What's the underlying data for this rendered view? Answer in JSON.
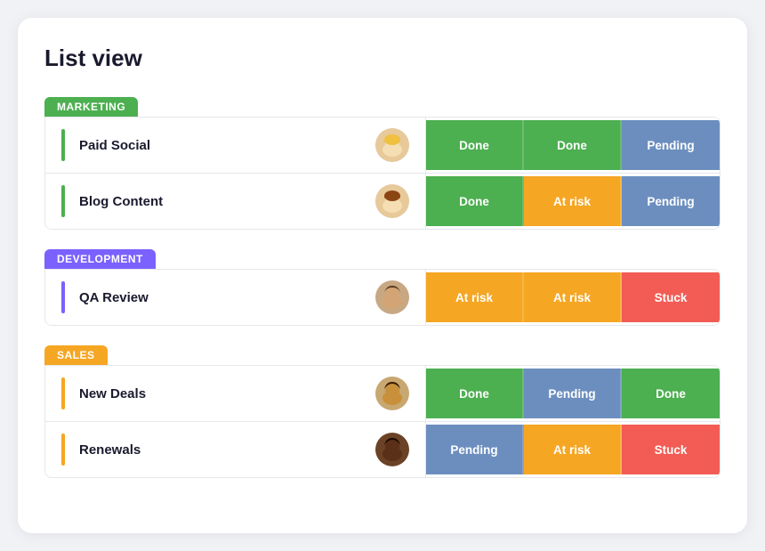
{
  "page": {
    "title": "List view"
  },
  "groups": [
    {
      "id": "marketing",
      "label": "MARKETING",
      "color": "#4caf50",
      "rows": [
        {
          "name": "Paid Social",
          "avatar": "👱‍♀️",
          "statuses": [
            {
              "label": "Done",
              "type": "done"
            },
            {
              "label": "Done",
              "type": "done"
            },
            {
              "label": "Pending",
              "type": "pending"
            }
          ]
        },
        {
          "name": "Blog Content",
          "avatar": "👩‍🦱",
          "statuses": [
            {
              "label": "Done",
              "type": "done"
            },
            {
              "label": "At risk",
              "type": "at-risk"
            },
            {
              "label": "Pending",
              "type": "pending"
            }
          ]
        }
      ]
    },
    {
      "id": "development",
      "label": "DEVELOPMENT",
      "color": "#7b61ff",
      "rows": [
        {
          "name": "QA Review",
          "avatar": "👨",
          "statuses": [
            {
              "label": "At risk",
              "type": "at-risk"
            },
            {
              "label": "At risk",
              "type": "at-risk"
            },
            {
              "label": "Stuck",
              "type": "stuck"
            }
          ]
        }
      ]
    },
    {
      "id": "sales",
      "label": "SALES",
      "color": "#f5a623",
      "rows": [
        {
          "name": "New Deals",
          "avatar": "👨🏽",
          "statuses": [
            {
              "label": "Done",
              "type": "done"
            },
            {
              "label": "Pending",
              "type": "pending"
            },
            {
              "label": "Done",
              "type": "done"
            }
          ]
        },
        {
          "name": "Renewals",
          "avatar": "👨🏿",
          "statuses": [
            {
              "label": "Pending",
              "type": "pending"
            },
            {
              "label": "At risk",
              "type": "at-risk"
            },
            {
              "label": "Stuck",
              "type": "stuck"
            }
          ]
        }
      ]
    }
  ],
  "avatars": {
    "👱‍♀️": "data:image/svg+xml,<svg xmlns='http://www.w3.org/2000/svg' width='38' height='38'><circle cx='19' cy='19' r='19' fill='%23f0c8a0'/></svg>"
  }
}
